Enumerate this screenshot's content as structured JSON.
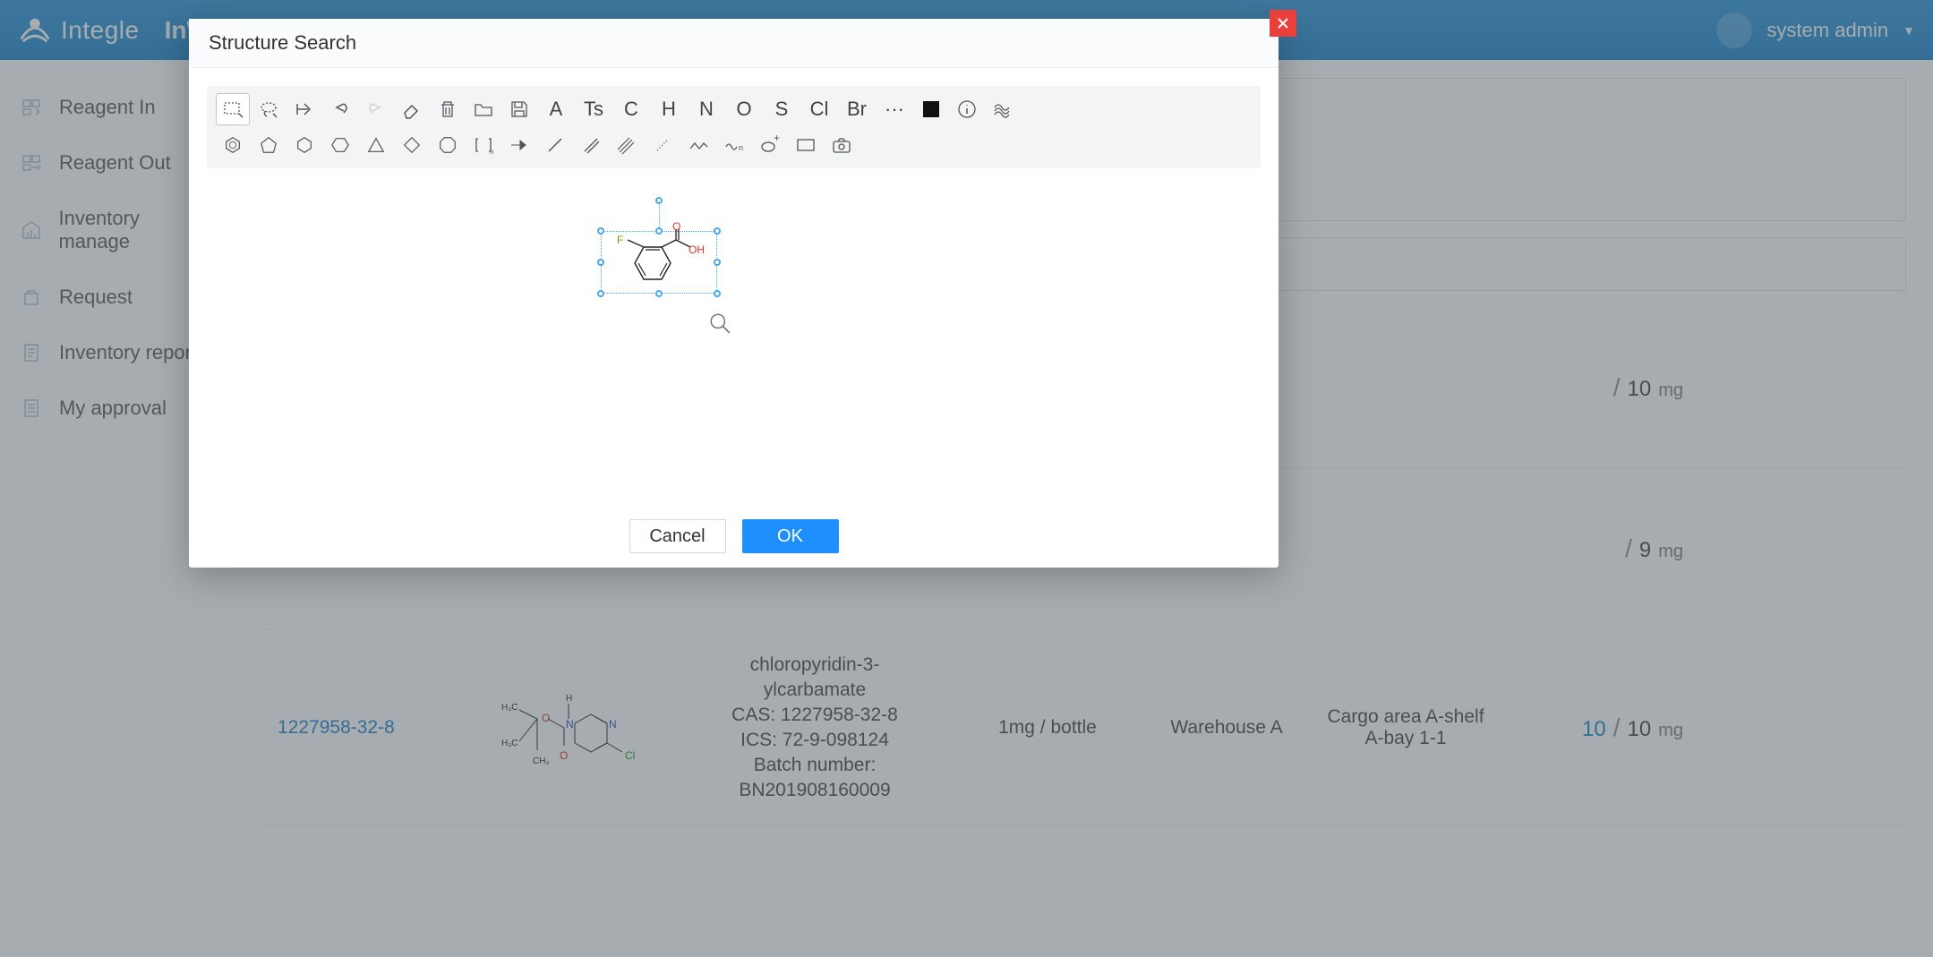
{
  "app": {
    "logo_text": "Integle",
    "product": "InWMS",
    "user_label": "system admin"
  },
  "sidebar": {
    "items": [
      {
        "label": "Reagent In",
        "icon": "in-icon"
      },
      {
        "label": "Reagent Out",
        "icon": "out-icon"
      },
      {
        "label": "Inventory manage",
        "icon": "inventory-icon"
      },
      {
        "label": "Request",
        "icon": "request-icon"
      },
      {
        "label": "Inventory report",
        "icon": "report-icon"
      },
      {
        "label": "My approval",
        "icon": "approval-icon"
      }
    ]
  },
  "table": {
    "rows": [
      {
        "cas": "",
        "spec": "",
        "warehouse": "",
        "area": "",
        "qty_left_sep": "/",
        "qty_right": "10",
        "qty_unit": "mg"
      },
      {
        "cas": "",
        "spec": "",
        "warehouse": "",
        "area": "",
        "qty_left_sep": "/",
        "qty_right": "9",
        "qty_unit": "mg"
      },
      {
        "cas": "1227958-32-8",
        "name_line1": "chloropyridin-3-",
        "name_line2": "ylcarbamate",
        "cas_label": "CAS: 1227958-32-8",
        "ics_label": "ICS: 72-9-098124",
        "batch_label": "Batch number:",
        "batch_value": "BN201908160009",
        "spec": "1mg / bottle",
        "warehouse": "Warehouse A",
        "area": "Cargo area A-shelf A-bay 1-1",
        "qty_left": "10",
        "qty_left_sep": "/",
        "qty_right": "10",
        "qty_unit": "mg"
      }
    ]
  },
  "modal": {
    "title": "Structure Search",
    "cancel": "Cancel",
    "ok": "OK",
    "atoms_row1": [
      "A",
      "Ts",
      "C",
      "H",
      "N",
      "O",
      "S",
      "Cl",
      "Br",
      "···"
    ],
    "structure_atoms": {
      "O": "O",
      "OH": "OH",
      "F": "F"
    }
  }
}
